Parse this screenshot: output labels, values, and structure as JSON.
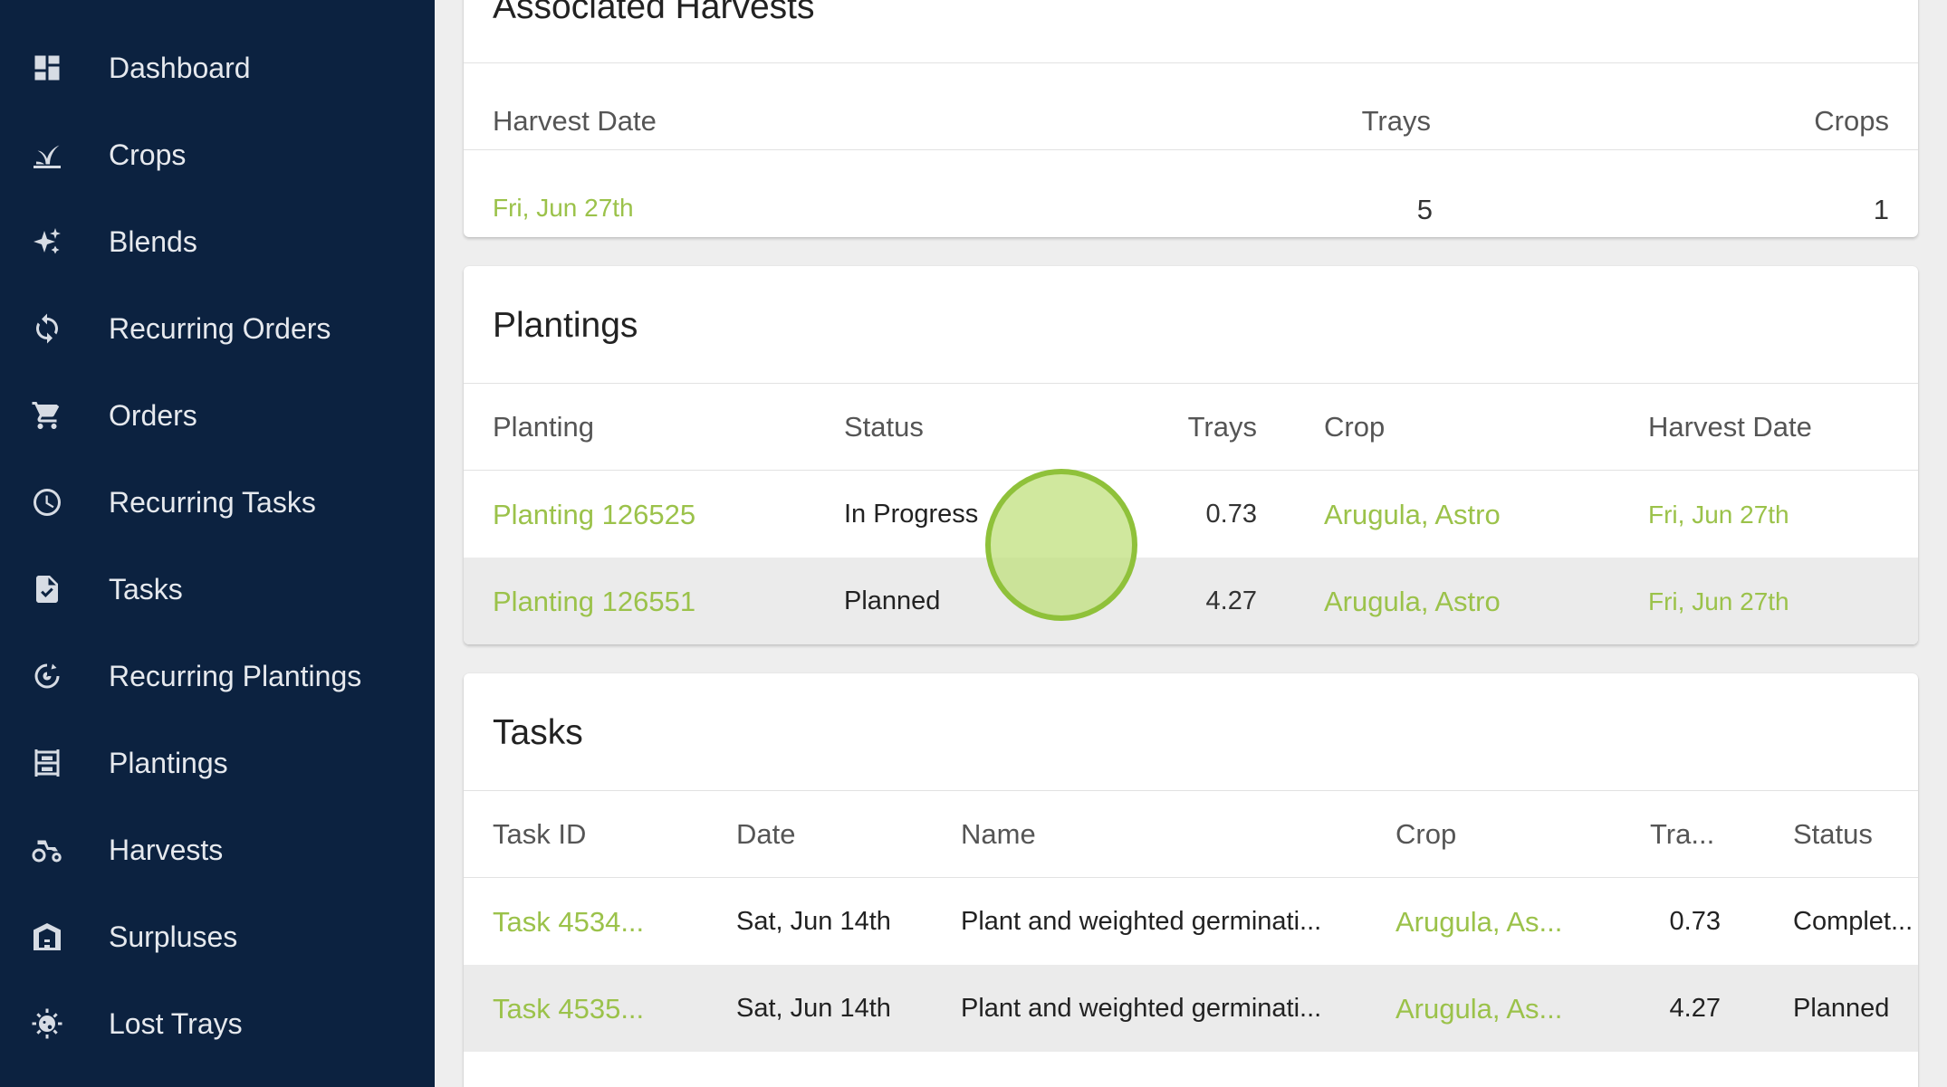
{
  "sidebar": {
    "items": [
      {
        "label": "Dashboard",
        "icon": "dashboard-icon"
      },
      {
        "label": "Crops",
        "icon": "sprout-icon"
      },
      {
        "label": "Blends",
        "icon": "sparkles-icon"
      },
      {
        "label": "Recurring Orders",
        "icon": "refresh-icon"
      },
      {
        "label": "Orders",
        "icon": "cart-icon"
      },
      {
        "label": "Recurring Tasks",
        "icon": "clock-icon"
      },
      {
        "label": "Tasks",
        "icon": "task-file-icon"
      },
      {
        "label": "Recurring Plantings",
        "icon": "recurring-planting-icon"
      },
      {
        "label": "Plantings",
        "icon": "shelves-icon"
      },
      {
        "label": "Harvests",
        "icon": "tractor-icon"
      },
      {
        "label": "Surpluses",
        "icon": "warehouse-icon"
      },
      {
        "label": "Lost Trays",
        "icon": "virus-icon"
      }
    ]
  },
  "harvests": {
    "title": "Associated Harvests",
    "columns": [
      "Harvest Date",
      "Trays",
      "Crops"
    ],
    "rows": [
      {
        "date": "Fri, Jun 27th",
        "trays": "5",
        "crops": "1"
      }
    ]
  },
  "plantings": {
    "title": "Plantings",
    "columns": [
      "Planting",
      "Status",
      "Trays",
      "Crop",
      "Harvest Date"
    ],
    "rows": [
      {
        "planting": "Planting 126525",
        "status": "In Progress",
        "trays": "0.73",
        "crop": "Arugula, Astro",
        "harvest_date": "Fri, Jun 27th"
      },
      {
        "planting": "Planting 126551",
        "status": "Planned",
        "trays": "4.27",
        "crop": "Arugula, Astro",
        "harvest_date": "Fri, Jun 27th"
      }
    ]
  },
  "tasks": {
    "title": "Tasks",
    "columns": [
      "Task ID",
      "Date",
      "Name",
      "Crop",
      "Tra...",
      "Status"
    ],
    "rows": [
      {
        "id": "Task 4534...",
        "date": "Sat, Jun 14th",
        "name": "Plant and weighted germinati...",
        "crop": "Arugula, As...",
        "trays": "0.73",
        "status": "Complet..."
      },
      {
        "id": "Task 4535...",
        "date": "Sat, Jun 14th",
        "name": "Plant and weighted germinati...",
        "crop": "Arugula, As...",
        "trays": "4.27",
        "status": "Planned"
      }
    ]
  },
  "colors": {
    "sidebar_bg": "#0c2240",
    "link_green": "#9bc24a",
    "ripple_green": "#8fc13a"
  }
}
